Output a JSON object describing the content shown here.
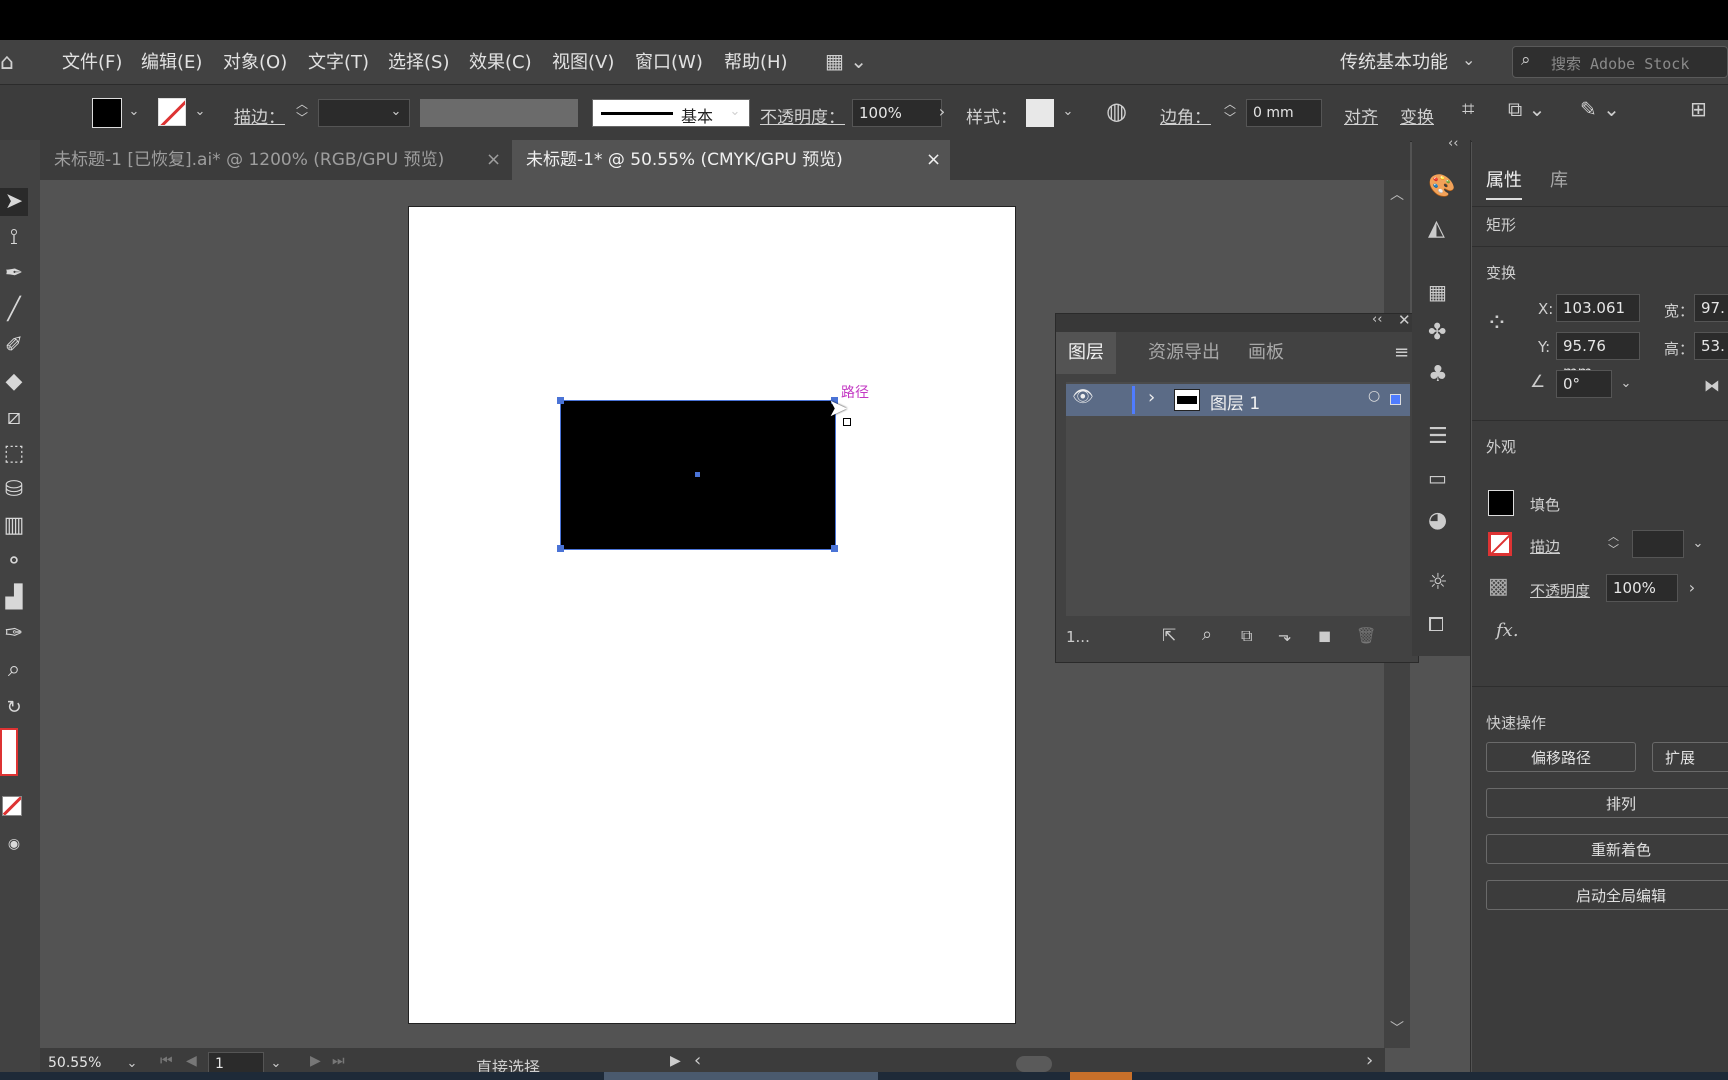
{
  "menubar": {
    "items": [
      "文件(F)",
      "编辑(E)",
      "对象(O)",
      "文字(T)",
      "选择(S)",
      "效果(C)",
      "视图(V)",
      "窗口(W)",
      "帮助(H)"
    ],
    "workspace": "传统基本功能",
    "stock_search_placeholder": "搜索 Adobe Stock"
  },
  "control": {
    "stroke_label": "描边：",
    "brush_label": "基本",
    "opacity_label": "不透明度：",
    "opacity_value": "100%",
    "style_label": "样式：",
    "corner_label": "边角：",
    "corner_value": "0 mm",
    "align_label": "对齐",
    "transform_label": "变换"
  },
  "tabs": [
    {
      "label": "未标题-1 [已恢复].ai* @ 1200% (RGB/GPU 预览)",
      "close": "×"
    },
    {
      "label": "未标题-1* @ 50.55% (CMYK/GPU 预览)",
      "close": "×"
    }
  ],
  "canvas": {
    "hint_label": "路径"
  },
  "layers_panel": {
    "tabs": [
      "图层",
      "资源导出",
      "画板"
    ],
    "layer_name": "图层 1",
    "footer_count": "1..."
  },
  "properties": {
    "tabs": [
      "属性",
      "库"
    ],
    "object_type": "矩形",
    "transform_heading": "变换",
    "x_label": "X:",
    "x_value": "103.061",
    "y_label": "Y:",
    "y_value": "95.76 mm",
    "w_label": "宽：",
    "w_value": "97.",
    "h_label": "高：",
    "h_value": "53.",
    "angle_value": "0°",
    "appearance_heading": "外观",
    "fill_label": "填色",
    "stroke_label": "描边",
    "opacity_label": "不透明度",
    "opacity_value": "100%",
    "fx_label": "fx.",
    "quick_heading": "快速操作",
    "btn_offset": "偏移路径",
    "btn_expand": "扩展",
    "btn_arrange": "排列",
    "btn_recolor": "重新着色",
    "btn_global": "启动全局编辑"
  },
  "status": {
    "zoom": "50.55%",
    "artboard_num": "1",
    "tool_name": "直接选择"
  },
  "colors": {
    "selection": "#4a73d6",
    "hint": "#c338c3",
    "panel": "#3c3c3c"
  }
}
